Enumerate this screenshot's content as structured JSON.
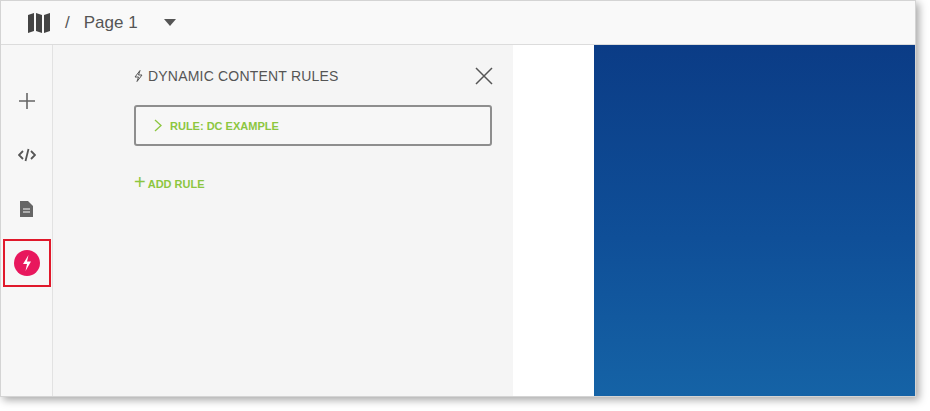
{
  "topbar": {
    "separator": "/",
    "page": "Page 1"
  },
  "sidebar": {
    "items": [
      {
        "kind": "add",
        "selected": false
      },
      {
        "kind": "code",
        "selected": false
      },
      {
        "kind": "page",
        "selected": false
      },
      {
        "kind": "dynamic",
        "selected": true
      }
    ]
  },
  "panel": {
    "title": "DYNAMIC CONTENT RULES",
    "rules": [
      {
        "label": "RULE: DC EXAMPLE",
        "expanded": false
      }
    ],
    "add_rule": {
      "icon": "+",
      "label": "ADD RULE"
    }
  }
}
